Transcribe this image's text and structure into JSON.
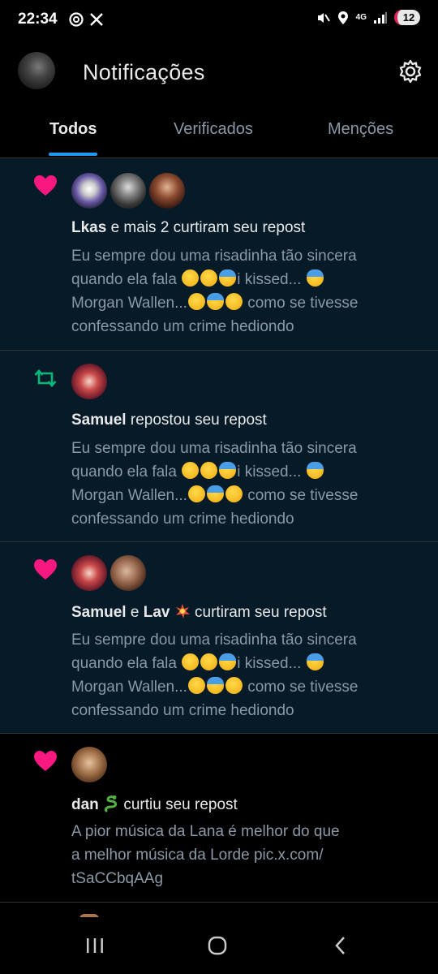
{
  "status_bar": {
    "time": "22:34",
    "network": "4G",
    "battery": "12",
    "icons": [
      "threads-icon",
      "x-logo-icon",
      "mute-vibrate-icon",
      "location-icon",
      "signal-icon"
    ]
  },
  "header": {
    "title": "Notificações",
    "settings_icon": "gear-icon"
  },
  "tabs": [
    {
      "label": "Todos",
      "active": true
    },
    {
      "label": "Verificados",
      "active": false
    },
    {
      "label": "Menções",
      "active": false
    }
  ],
  "notifications": [
    {
      "type": "like",
      "unread": true,
      "actor": "Lkas",
      "action": " e mais 2 curtiram seu repost",
      "body_lines": [
        "Eu sempre dou uma risadinha tão sincera",
        "quando ela fala",
        "i kissed...",
        "Morgan Wallen...",
        " como se tivesse",
        "confessando um crime hediondo"
      ]
    },
    {
      "type": "repost",
      "unread": true,
      "actor": "Samuel",
      "action": " repostou seu repost",
      "body_lines": [
        "Eu sempre dou uma risadinha tão sincera",
        "quando ela fala",
        "i kissed...",
        "Morgan Wallen...",
        " como se tivesse",
        "confessando um crime hediondo"
      ]
    },
    {
      "type": "like",
      "unread": true,
      "actor": "Samuel",
      "connector": " e ",
      "actor2": "Lav",
      "action": " curtiram seu repost",
      "body_lines": [
        "Eu sempre dou uma risadinha tão sincera",
        "quando ela fala",
        "i kissed...",
        "Morgan Wallen...",
        " como se tivesse",
        "confessando um crime hediondo"
      ]
    },
    {
      "type": "like",
      "unread": false,
      "actor": "dan",
      "action": " curtiu seu repost",
      "body_lines": [
        "A pior música da Lana é melhor do que",
        "a melhor música da Lorde pic.x.com/",
        "tSaCCbqAAg"
      ]
    }
  ],
  "colors": {
    "accent": "#1d9bf0",
    "like": "#f91880",
    "repost": "#00ba7c",
    "unread_bg": "#061a27"
  },
  "navbar": [
    "recent-apps-icon",
    "home-icon",
    "back-icon"
  ]
}
